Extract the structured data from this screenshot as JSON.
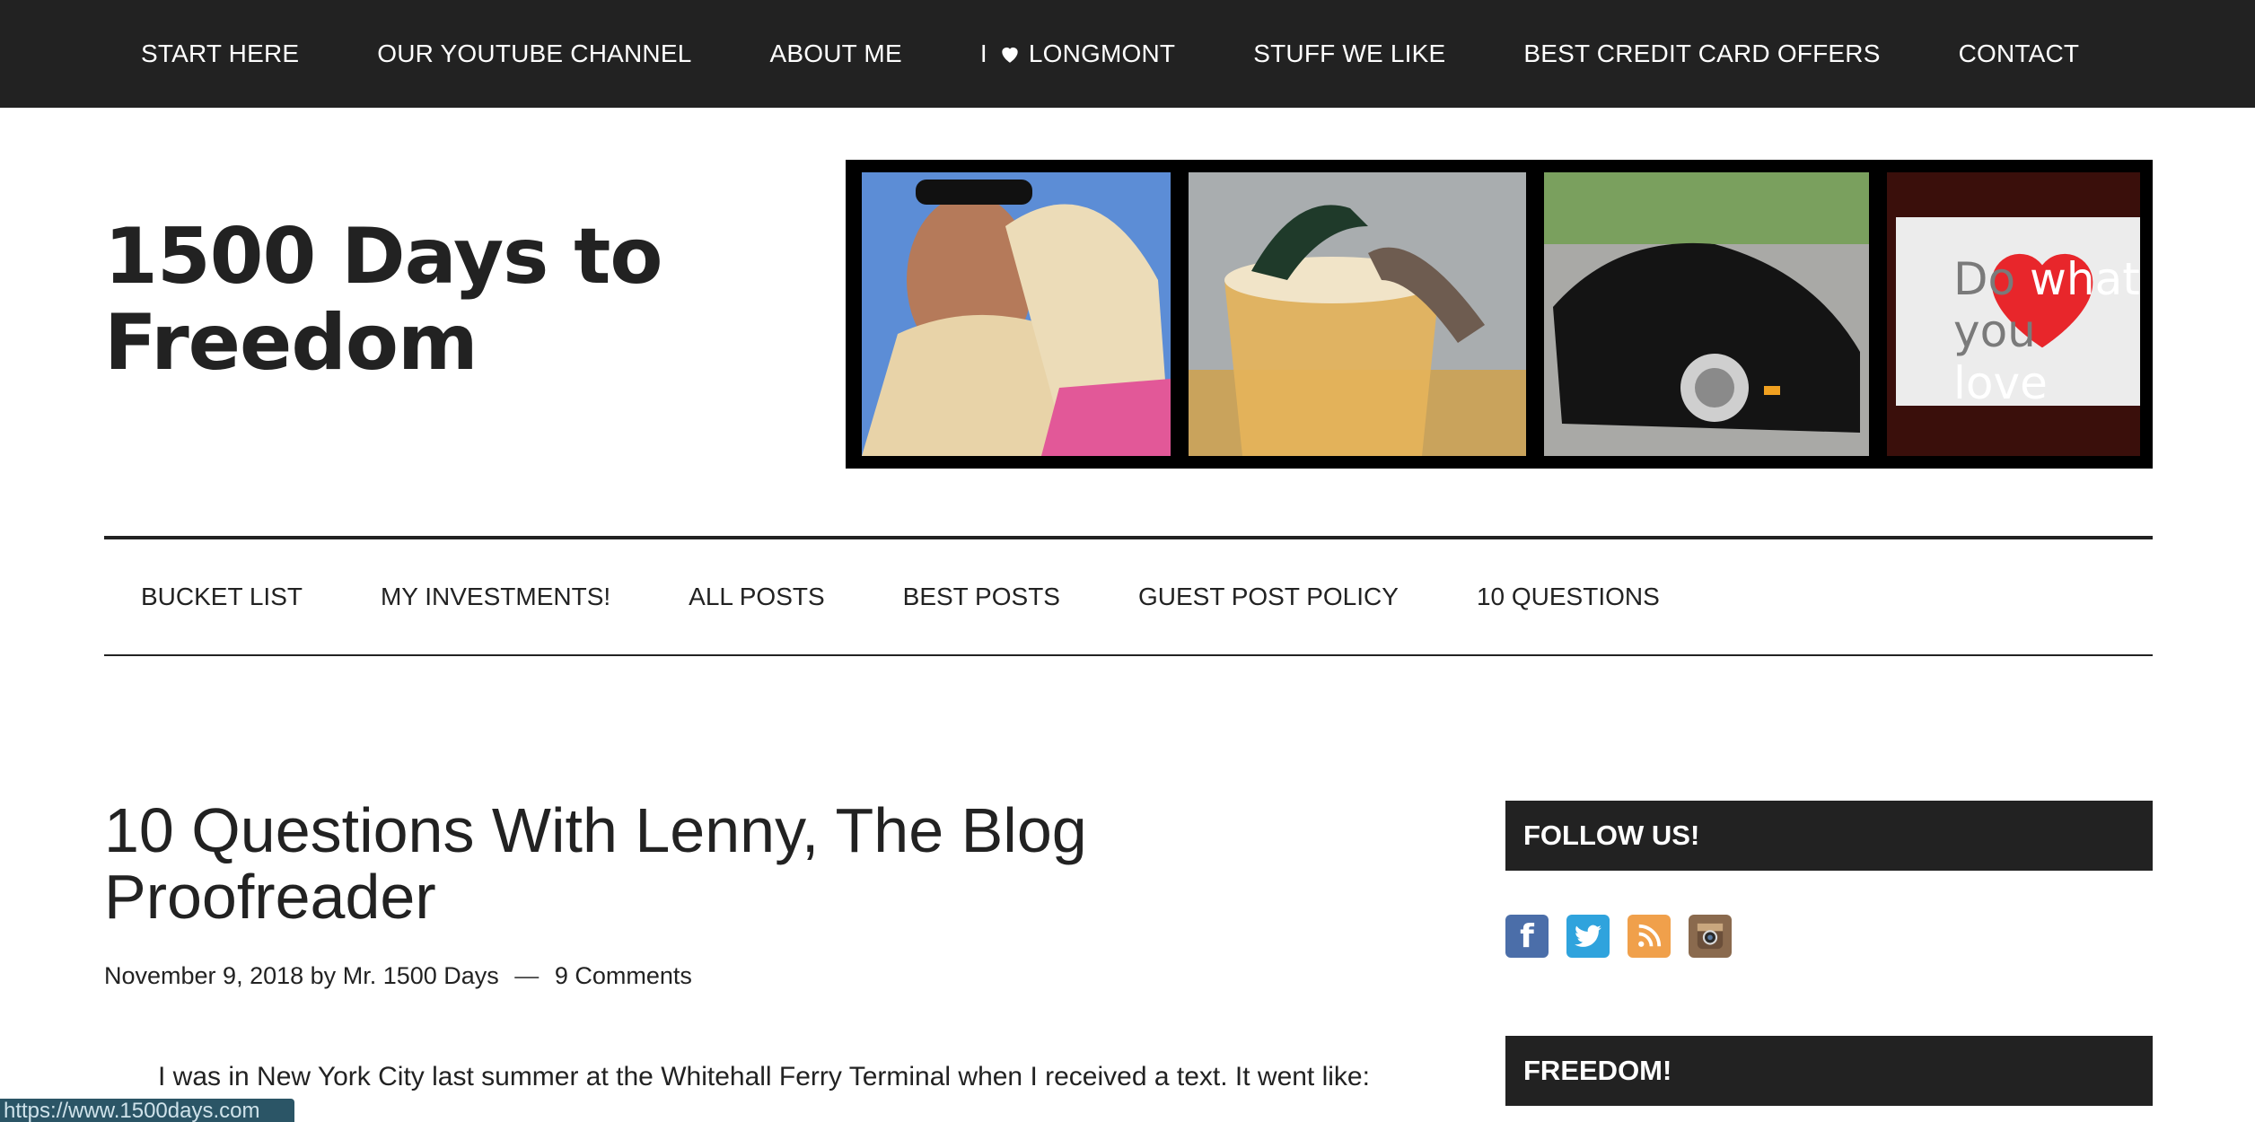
{
  "top_nav": {
    "items": [
      {
        "label": "START HERE"
      },
      {
        "label": "OUR YOUTUBE CHANNEL"
      },
      {
        "label": "ABOUT ME"
      },
      {
        "label_prefix": "I",
        "label": "LONGMONT"
      },
      {
        "label": "STUFF WE LIKE"
      },
      {
        "label": "BEST CREDIT CARD OFFERS"
      },
      {
        "label": "CONTACT"
      }
    ]
  },
  "header": {
    "site_title": "1500 Days to Freedom",
    "banner": {
      "sign_text_word1_start": "Do",
      "sign_text_word1_end": "what",
      "sign_text_word2_start": "you",
      "sign_text_word2_end": "love"
    }
  },
  "sub_nav": {
    "items": [
      {
        "label": "BUCKET LIST"
      },
      {
        "label": "MY INVESTMENTS!"
      },
      {
        "label": "ALL POSTS"
      },
      {
        "label": "BEST POSTS"
      },
      {
        "label": "GUEST POST POLICY"
      },
      {
        "label": "10 QUESTIONS"
      }
    ]
  },
  "post": {
    "title": "10 Questions With Lenny, The Blog Proofreader",
    "date": "November 9, 2018",
    "by": "by",
    "author": "Mr. 1500 Days",
    "dash": "—",
    "comments": "9 Comments",
    "excerpt": "I was in New York City last summer at the Whitehall Ferry Terminal when I received a text. It went like:"
  },
  "sidebar": {
    "follow_title": "FOLLOW US!",
    "social_icons": [
      "facebook-icon",
      "twitter-icon",
      "rss-icon",
      "instagram-icon"
    ],
    "freedom_title": "FREEDOM!"
  },
  "status_bar": {
    "url": "https://www.1500days.com"
  },
  "colors": {
    "dark": "#222222",
    "white": "#ffffff",
    "facebook": "#4b6ea9",
    "twitter": "#2fa3dd",
    "rss": "#f0a04b",
    "heart": "#e8262b"
  }
}
